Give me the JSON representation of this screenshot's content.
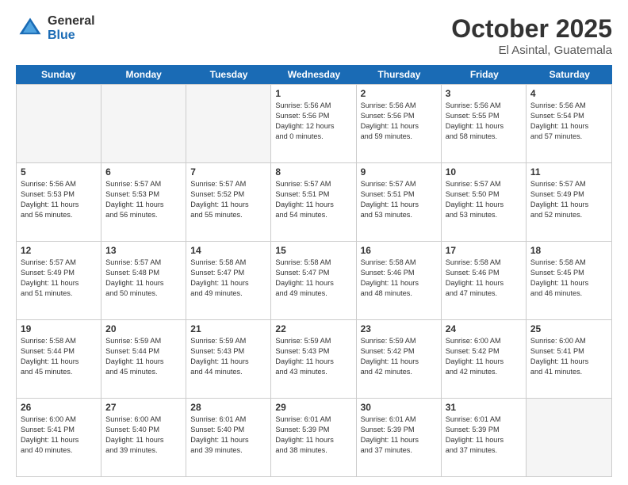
{
  "logo": {
    "general": "General",
    "blue": "Blue"
  },
  "header": {
    "month": "October 2025",
    "location": "El Asintal, Guatemala"
  },
  "days_of_week": [
    "Sunday",
    "Monday",
    "Tuesday",
    "Wednesday",
    "Thursday",
    "Friday",
    "Saturday"
  ],
  "weeks": [
    [
      {
        "day": "",
        "info": "",
        "empty": true
      },
      {
        "day": "",
        "info": "",
        "empty": true
      },
      {
        "day": "",
        "info": "",
        "empty": true
      },
      {
        "day": "1",
        "info": "Sunrise: 5:56 AM\nSunset: 5:56 PM\nDaylight: 12 hours\nand 0 minutes.",
        "empty": false
      },
      {
        "day": "2",
        "info": "Sunrise: 5:56 AM\nSunset: 5:56 PM\nDaylight: 11 hours\nand 59 minutes.",
        "empty": false
      },
      {
        "day": "3",
        "info": "Sunrise: 5:56 AM\nSunset: 5:55 PM\nDaylight: 11 hours\nand 58 minutes.",
        "empty": false
      },
      {
        "day": "4",
        "info": "Sunrise: 5:56 AM\nSunset: 5:54 PM\nDaylight: 11 hours\nand 57 minutes.",
        "empty": false
      }
    ],
    [
      {
        "day": "5",
        "info": "Sunrise: 5:56 AM\nSunset: 5:53 PM\nDaylight: 11 hours\nand 56 minutes.",
        "empty": false
      },
      {
        "day": "6",
        "info": "Sunrise: 5:57 AM\nSunset: 5:53 PM\nDaylight: 11 hours\nand 56 minutes.",
        "empty": false
      },
      {
        "day": "7",
        "info": "Sunrise: 5:57 AM\nSunset: 5:52 PM\nDaylight: 11 hours\nand 55 minutes.",
        "empty": false
      },
      {
        "day": "8",
        "info": "Sunrise: 5:57 AM\nSunset: 5:51 PM\nDaylight: 11 hours\nand 54 minutes.",
        "empty": false
      },
      {
        "day": "9",
        "info": "Sunrise: 5:57 AM\nSunset: 5:51 PM\nDaylight: 11 hours\nand 53 minutes.",
        "empty": false
      },
      {
        "day": "10",
        "info": "Sunrise: 5:57 AM\nSunset: 5:50 PM\nDaylight: 11 hours\nand 53 minutes.",
        "empty": false
      },
      {
        "day": "11",
        "info": "Sunrise: 5:57 AM\nSunset: 5:49 PM\nDaylight: 11 hours\nand 52 minutes.",
        "empty": false
      }
    ],
    [
      {
        "day": "12",
        "info": "Sunrise: 5:57 AM\nSunset: 5:49 PM\nDaylight: 11 hours\nand 51 minutes.",
        "empty": false
      },
      {
        "day": "13",
        "info": "Sunrise: 5:57 AM\nSunset: 5:48 PM\nDaylight: 11 hours\nand 50 minutes.",
        "empty": false
      },
      {
        "day": "14",
        "info": "Sunrise: 5:58 AM\nSunset: 5:47 PM\nDaylight: 11 hours\nand 49 minutes.",
        "empty": false
      },
      {
        "day": "15",
        "info": "Sunrise: 5:58 AM\nSunset: 5:47 PM\nDaylight: 11 hours\nand 49 minutes.",
        "empty": false
      },
      {
        "day": "16",
        "info": "Sunrise: 5:58 AM\nSunset: 5:46 PM\nDaylight: 11 hours\nand 48 minutes.",
        "empty": false
      },
      {
        "day": "17",
        "info": "Sunrise: 5:58 AM\nSunset: 5:46 PM\nDaylight: 11 hours\nand 47 minutes.",
        "empty": false
      },
      {
        "day": "18",
        "info": "Sunrise: 5:58 AM\nSunset: 5:45 PM\nDaylight: 11 hours\nand 46 minutes.",
        "empty": false
      }
    ],
    [
      {
        "day": "19",
        "info": "Sunrise: 5:58 AM\nSunset: 5:44 PM\nDaylight: 11 hours\nand 45 minutes.",
        "empty": false
      },
      {
        "day": "20",
        "info": "Sunrise: 5:59 AM\nSunset: 5:44 PM\nDaylight: 11 hours\nand 45 minutes.",
        "empty": false
      },
      {
        "day": "21",
        "info": "Sunrise: 5:59 AM\nSunset: 5:43 PM\nDaylight: 11 hours\nand 44 minutes.",
        "empty": false
      },
      {
        "day": "22",
        "info": "Sunrise: 5:59 AM\nSunset: 5:43 PM\nDaylight: 11 hours\nand 43 minutes.",
        "empty": false
      },
      {
        "day": "23",
        "info": "Sunrise: 5:59 AM\nSunset: 5:42 PM\nDaylight: 11 hours\nand 42 minutes.",
        "empty": false
      },
      {
        "day": "24",
        "info": "Sunrise: 6:00 AM\nSunset: 5:42 PM\nDaylight: 11 hours\nand 42 minutes.",
        "empty": false
      },
      {
        "day": "25",
        "info": "Sunrise: 6:00 AM\nSunset: 5:41 PM\nDaylight: 11 hours\nand 41 minutes.",
        "empty": false
      }
    ],
    [
      {
        "day": "26",
        "info": "Sunrise: 6:00 AM\nSunset: 5:41 PM\nDaylight: 11 hours\nand 40 minutes.",
        "empty": false
      },
      {
        "day": "27",
        "info": "Sunrise: 6:00 AM\nSunset: 5:40 PM\nDaylight: 11 hours\nand 39 minutes.",
        "empty": false
      },
      {
        "day": "28",
        "info": "Sunrise: 6:01 AM\nSunset: 5:40 PM\nDaylight: 11 hours\nand 39 minutes.",
        "empty": false
      },
      {
        "day": "29",
        "info": "Sunrise: 6:01 AM\nSunset: 5:39 PM\nDaylight: 11 hours\nand 38 minutes.",
        "empty": false
      },
      {
        "day": "30",
        "info": "Sunrise: 6:01 AM\nSunset: 5:39 PM\nDaylight: 11 hours\nand 37 minutes.",
        "empty": false
      },
      {
        "day": "31",
        "info": "Sunrise: 6:01 AM\nSunset: 5:39 PM\nDaylight: 11 hours\nand 37 minutes.",
        "empty": false
      },
      {
        "day": "",
        "info": "",
        "empty": true
      }
    ]
  ]
}
